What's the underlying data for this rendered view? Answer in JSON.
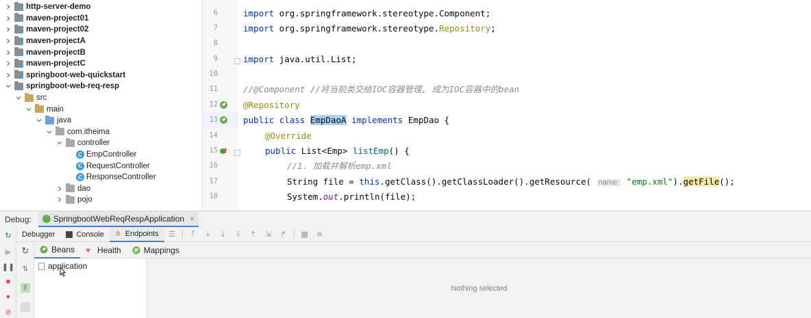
{
  "tree": [
    {
      "label": "http-server-demo",
      "depth": 0,
      "expanded": false,
      "kind": "module",
      "bold": true
    },
    {
      "label": "maven-project01",
      "depth": 0,
      "expanded": false,
      "kind": "module",
      "bold": true
    },
    {
      "label": "maven-project02",
      "depth": 0,
      "expanded": false,
      "kind": "module",
      "bold": true
    },
    {
      "label": "maven-projectA",
      "depth": 0,
      "expanded": false,
      "kind": "module",
      "bold": true
    },
    {
      "label": "maven-projectB",
      "depth": 0,
      "expanded": false,
      "kind": "module",
      "bold": true
    },
    {
      "label": "maven-projectC",
      "depth": 0,
      "expanded": false,
      "kind": "module",
      "bold": true
    },
    {
      "label": "springboot-web-quickstart",
      "depth": 0,
      "expanded": false,
      "kind": "module",
      "bold": true
    },
    {
      "label": "springboot-web-req-resp",
      "depth": 0,
      "expanded": true,
      "kind": "module",
      "bold": true
    },
    {
      "label": "src",
      "depth": 1,
      "expanded": true,
      "kind": "folder",
      "bold": false
    },
    {
      "label": "main",
      "depth": 2,
      "expanded": true,
      "kind": "folder",
      "bold": false
    },
    {
      "label": "java",
      "depth": 3,
      "expanded": true,
      "kind": "source",
      "bold": false
    },
    {
      "label": "com.itheima",
      "depth": 4,
      "expanded": true,
      "kind": "package",
      "bold": false
    },
    {
      "label": "controller",
      "depth": 5,
      "expanded": true,
      "kind": "package",
      "bold": false
    },
    {
      "label": "EmpController",
      "depth": 6,
      "expanded": null,
      "kind": "class",
      "bold": false
    },
    {
      "label": "RequestController",
      "depth": 6,
      "expanded": null,
      "kind": "class",
      "bold": false
    },
    {
      "label": "ResponseController",
      "depth": 6,
      "expanded": null,
      "kind": "class",
      "bold": false
    },
    {
      "label": "dao",
      "depth": 5,
      "expanded": false,
      "kind": "package",
      "bold": false
    },
    {
      "label": "pojo",
      "depth": 5,
      "expanded": false,
      "kind": "package",
      "bold": false
    }
  ],
  "editor": {
    "line_numbers": [
      "6",
      "7",
      "8",
      "9",
      "10",
      "11",
      "12",
      "13",
      "14",
      "15",
      "16",
      "17",
      "18"
    ],
    "lines": {
      "l6": {
        "kw": "import",
        "rest": " org.springframework.stereotype.Component;"
      },
      "l7": {
        "kw": "import",
        "rest": " org.springframework.stereotype.",
        "ann": "Repository",
        "end": ";"
      },
      "l9": {
        "kw": "import",
        "rest": " java.util.List;"
      },
      "l11": {
        "comment": "//@Component //将当前类交给IOC容器管理, 成为IOC容器中的bean"
      },
      "l12": {
        "ann": "@Repository"
      },
      "l13": {
        "kw1": "public",
        "kw2": "class",
        "sel": "EmpDaoA",
        "kw3": "implements",
        "rest": "EmpDao {"
      },
      "l14": {
        "ann": "@Override"
      },
      "l15": {
        "kw": "public",
        "type": "List<Emp>",
        "method": "listEmp",
        "rest": "() {"
      },
      "l16": {
        "comment": "//1. 加载并解析emp.xml"
      },
      "l17": {
        "p1": "String file = ",
        "kw": "this",
        "p2": ".getClass().getClassLoader().getResource(",
        "hint": "name:",
        "str": "\"emp.xml\"",
        "p3": ").",
        "hl": "getFile",
        "p4": "();"
      },
      "l18": {
        "p1": "System.",
        "field": "out",
        "p2": ".println(file);"
      }
    }
  },
  "debug": {
    "label": "Debug:",
    "run_config": "SpringbootWebReqRespApplication",
    "tabs": [
      "Debugger",
      "Console",
      "Endpoints"
    ],
    "active_tab": "Endpoints",
    "endpoint_tabs": [
      "Beans",
      "Health",
      "Mappings"
    ],
    "active_endpoint_tab": "Beans",
    "bean_item": "application",
    "details_empty": "Nothing selected"
  },
  "colors": {
    "keyword": "#0033b3",
    "annotation": "#9e880d",
    "comment": "#8c8c8c",
    "string": "#067d17",
    "selection": "#aad3f4",
    "accent": "#4083c9"
  }
}
